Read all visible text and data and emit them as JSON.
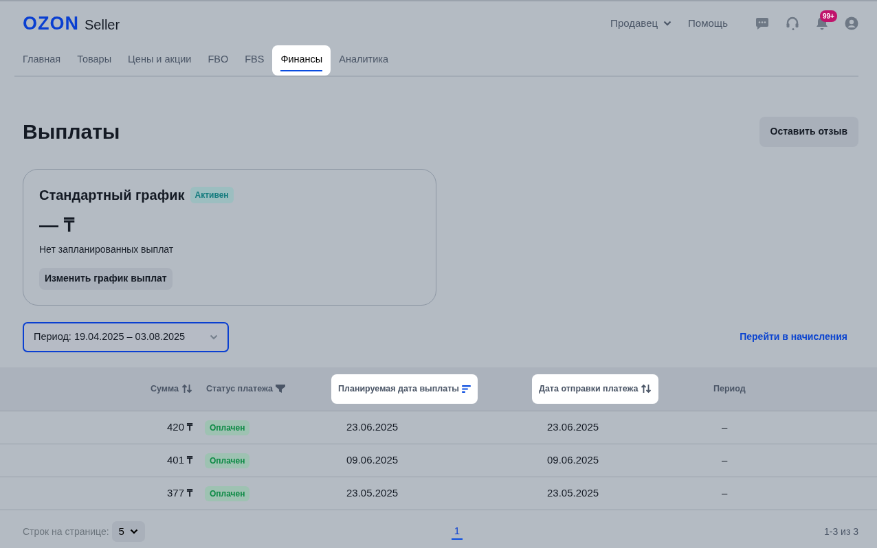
{
  "header": {
    "logo": "OZON",
    "logo_suffix": "Seller",
    "menu": [
      {
        "label": "Продавец",
        "dropdown": true
      },
      {
        "label": "Помощь",
        "dropdown": false
      }
    ],
    "notification_count": "99+"
  },
  "tabs": [
    {
      "label": "Главная",
      "selected": false,
      "highlighted": false
    },
    {
      "label": "Товары",
      "selected": false,
      "highlighted": false
    },
    {
      "label": "Цены и акции",
      "selected": false,
      "highlighted": false
    },
    {
      "label": "FBO",
      "selected": false,
      "highlighted": false
    },
    {
      "label": "FBS",
      "selected": false,
      "highlighted": false
    },
    {
      "label": "Финансы",
      "selected": true,
      "highlighted": true
    },
    {
      "label": "Аналитика",
      "selected": false,
      "highlighted": false
    }
  ],
  "page_title": "Выплаты",
  "feedback_button": "Оставить отзыв",
  "schedule_card": {
    "title": "Стандартный график",
    "status": "Активен",
    "amount": "—",
    "currency": "₸",
    "note": "Нет запланированных выплат",
    "button": "Изменить график выплат"
  },
  "period_select": {
    "value": "Период: 19.04.2025 – 03.08.2025"
  },
  "accruals_link": "Перейти в начисления",
  "table": {
    "columns": [
      {
        "label": "Сумма",
        "kind": "sortable",
        "highlighted": false
      },
      {
        "label": "Статус платежа",
        "kind": "filterable",
        "highlighted": false
      },
      {
        "label": "Планируемая дата выплаты",
        "kind": "sorted",
        "highlighted": true
      },
      {
        "label": "Дата отправки платежа",
        "kind": "sortable",
        "highlighted": true
      },
      {
        "label": "Период",
        "kind": "plain",
        "highlighted": false
      }
    ],
    "rows": [
      {
        "amount": "420",
        "currency": "₸",
        "status": "Оплачен",
        "planned_date": "23.06.2025",
        "sent_date": "23.06.2025",
        "period": "–"
      },
      {
        "amount": "401",
        "currency": "₸",
        "status": "Оплачен",
        "planned_date": "09.06.2025",
        "sent_date": "09.06.2025",
        "period": "–"
      },
      {
        "amount": "377",
        "currency": "₸",
        "status": "Оплачен",
        "planned_date": "23.05.2025",
        "sent_date": "23.05.2025",
        "period": "–"
      }
    ]
  },
  "pagination": {
    "rows_label": "Строк на странице:",
    "rows_per_page": "5",
    "pages": [
      {
        "label": "1",
        "selected": true
      }
    ],
    "range": "1-3 из 3"
  }
}
